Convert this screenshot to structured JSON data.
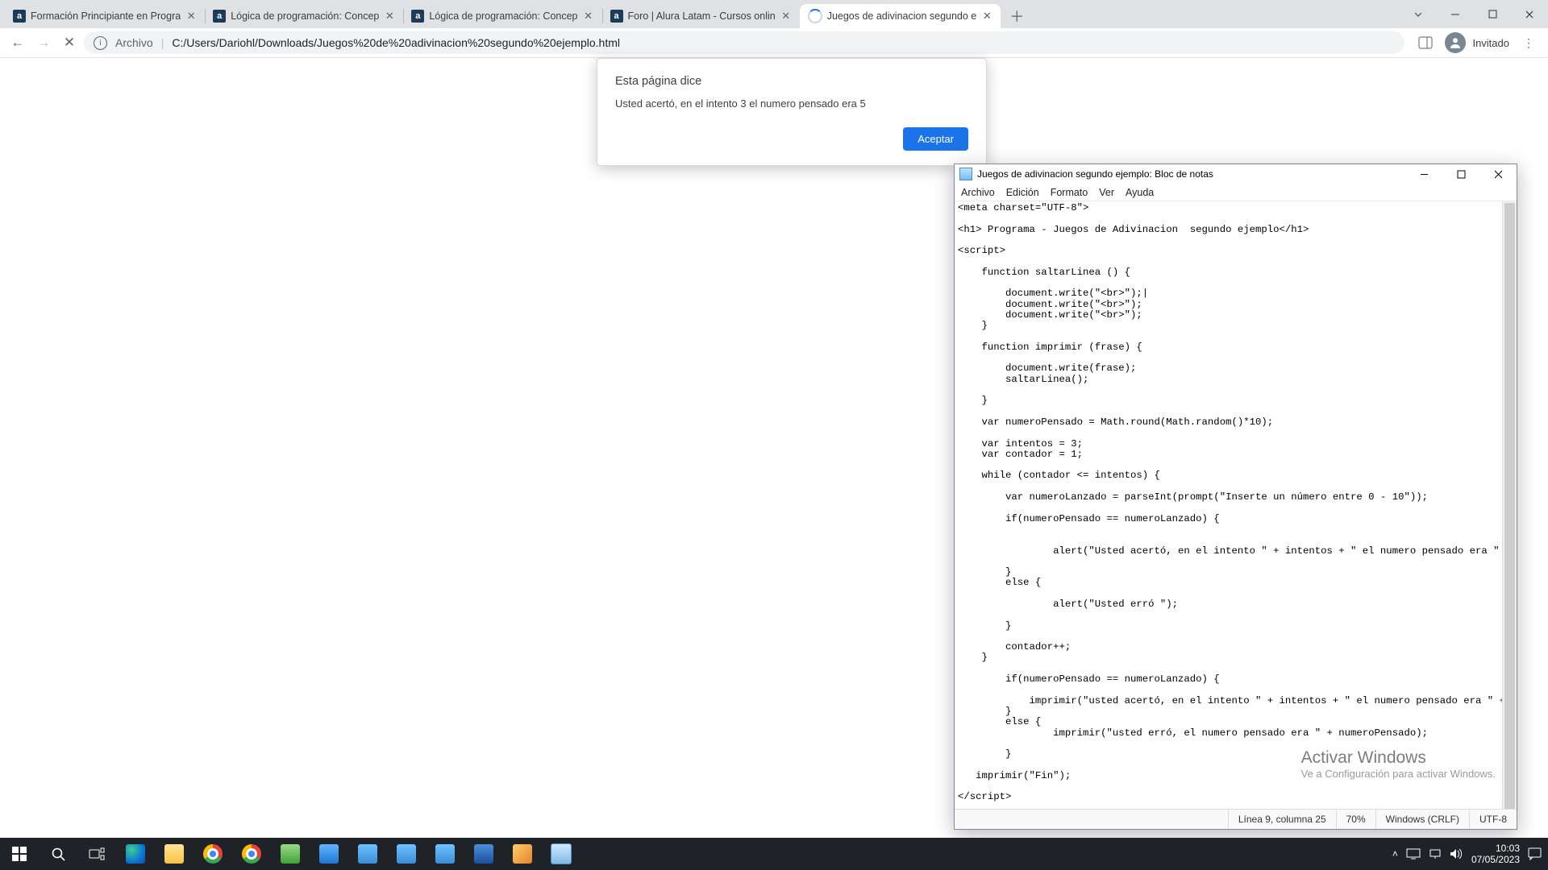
{
  "tabs": [
    {
      "label": "Formación Principiante en Progra",
      "fav": "a"
    },
    {
      "label": "Lógica de programación: Concep",
      "fav": "a"
    },
    {
      "label": "Lógica de programación: Concep",
      "fav": "a"
    },
    {
      "label": "Foro | Alura Latam - Cursos onlin",
      "fav": "a"
    },
    {
      "label": "Juegos de adivinacion segundo e",
      "fav": "spin",
      "active": true
    }
  ],
  "address": {
    "scheme_label": "Archivo",
    "path": "C:/Users/Dariohl/Downloads/Juegos%20de%20adivinacion%20segundo%20ejemplo.html"
  },
  "profile": {
    "label": "Invitado"
  },
  "alert": {
    "title": "Esta página dice",
    "message": "Usted acertó, en el intento 3 el numero pensado era 5",
    "button": "Aceptar"
  },
  "notepad": {
    "title": "Juegos de adivinacion segundo ejemplo: Bloc de notas",
    "menu": [
      "Archivo",
      "Edición",
      "Formato",
      "Ver",
      "Ayuda"
    ],
    "status": {
      "caret": "Línea 9, columna 25",
      "zoom": "70%",
      "eol": "Windows (CRLF)",
      "enc": "UTF-8"
    },
    "content": "<meta charset=\"UTF-8\">\n\n<h1> Programa - Juegos de Adivinacion  segundo ejemplo</h1>\n\n<script>\n\n    function saltarLinea () {\n\n        document.write(\"<br>\");|\n        document.write(\"<br>\");\n        document.write(\"<br>\");\n    }\n\n    function imprimir (frase) {\n\n        document.write(frase);\n        saltarLinea();\n\n    }\n\n    var numeroPensado = Math.round(Math.random()*10);\n\n    var intentos = 3;\n    var contador = 1;\n\n    while (contador <= intentos) {\n\n        var numeroLanzado = parseInt(prompt(\"Inserte un número entre 0 - 10\"));\n\n        if(numeroPensado == numeroLanzado) {\n\n\n                alert(\"Usted acertó, en el intento \" + intentos + \" el numero pensado era \" + numeroPensado);\n\n        }\n        else {\n\n                alert(\"Usted erró \");\n\n        }\n\n        contador++;\n    }\n\n        if(numeroPensado == numeroLanzado) {\n\n            imprimir(\"usted acertó, en el intento \" + intentos + \" el numero pensado era \" + numeroPensado);\n        }\n        else {\n                imprimir(\"usted erró, el numero pensado era \" + numeroPensado);\n\n        }\n\n   imprimir(\"Fin\");\n\n</script>"
  },
  "watermark": {
    "line1": "Activar Windows",
    "line2": "Ve a Configuración para activar Windows."
  },
  "taskbar": {
    "apps": [
      "start",
      "search",
      "taskview",
      "edge",
      "explorer",
      "chrome",
      "chrome2",
      "app1",
      "app2",
      "app3",
      "app4",
      "app5",
      "app6",
      "paint",
      "notepad"
    ],
    "time": "10:03",
    "date": "07/05/2023"
  }
}
